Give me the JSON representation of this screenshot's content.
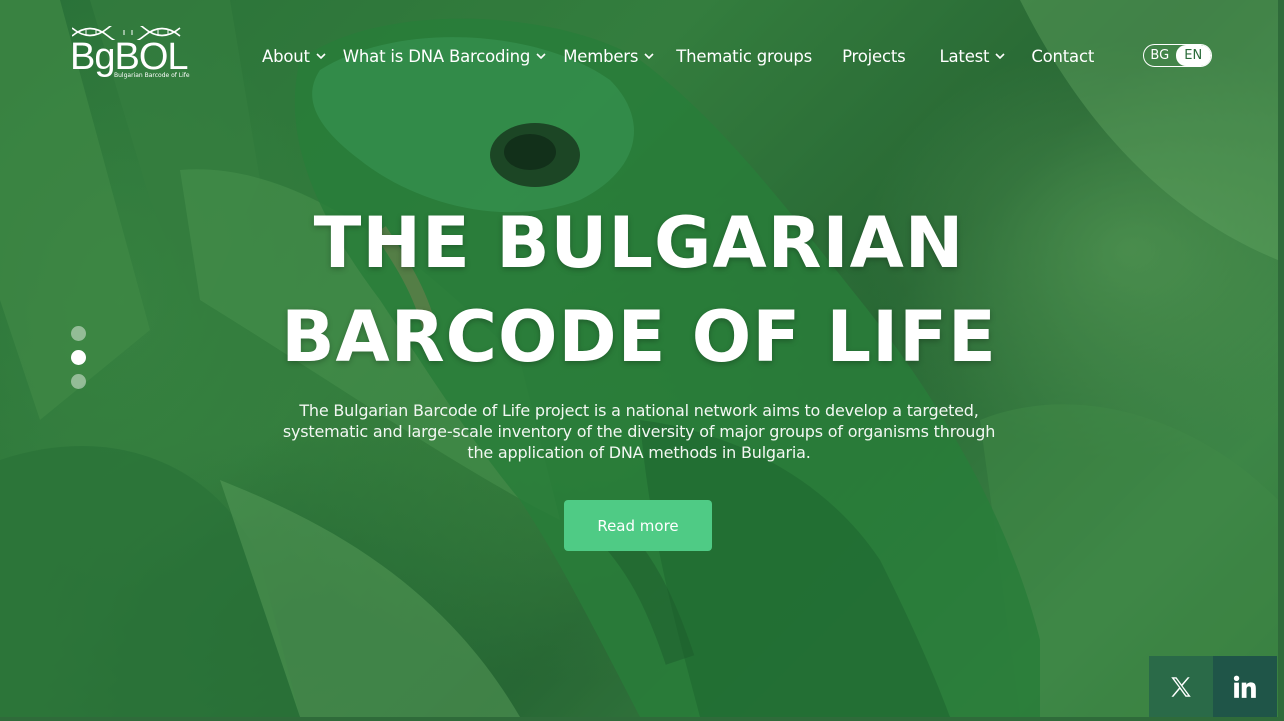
{
  "logo": {
    "text": "BgBOL",
    "tagline": "Bulgarian Barcode of Life"
  },
  "nav": {
    "items": [
      {
        "label": "About",
        "has_dropdown": true
      },
      {
        "label": "What is DNA Barcoding",
        "has_dropdown": true
      },
      {
        "label": "Members",
        "has_dropdown": true
      },
      {
        "label": "Thematic groups",
        "has_dropdown": false
      },
      {
        "label": "Projects",
        "has_dropdown": false
      },
      {
        "label": "Latest",
        "has_dropdown": true
      },
      {
        "label": "Contact",
        "has_dropdown": false
      }
    ]
  },
  "language": {
    "options": [
      "BG",
      "EN"
    ],
    "selected": "EN"
  },
  "hero": {
    "title_line1": "THE BULGARIAN",
    "title_line2": "BARCODE OF LIFE",
    "description": "The Bulgarian Barcode of Life project is a national network aims to develop a targeted, systematic and large-scale inventory of the diversity of major groups of organisms through the application of DNA methods in Bulgaria.",
    "cta_label": "Read more"
  },
  "slider": {
    "slide_count": 3,
    "active_index": 1
  },
  "social": [
    {
      "icon": "x-twitter-icon"
    },
    {
      "icon": "linkedin-icon"
    }
  ],
  "colors": {
    "accent": "#4fcb85",
    "overlay_green": "#2f7a3c",
    "social_x_bg": "#2a6a48",
    "social_linkedin_bg": "#1f5548"
  }
}
